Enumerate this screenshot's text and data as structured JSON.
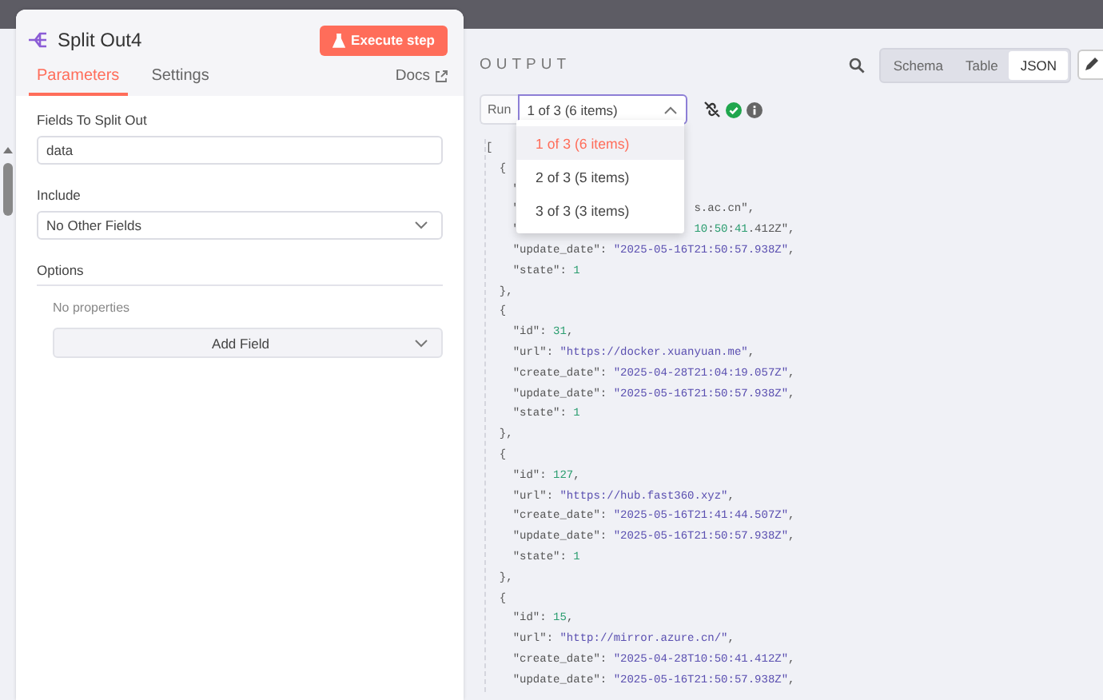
{
  "node": {
    "title": "Split Out4",
    "execute_button": "Execute step",
    "tabs": [
      {
        "label": "Parameters",
        "selected": true
      },
      {
        "label": "Settings",
        "selected": false
      }
    ],
    "docs_link": "Docs",
    "fields": [
      {
        "kind": "text",
        "label": "Fields To Split Out",
        "value": "data"
      },
      {
        "kind": "select",
        "label": "Include",
        "value": "No Other Fields"
      }
    ],
    "options": {
      "label": "Options",
      "empty_text": "No properties",
      "add_button": "Add Field"
    }
  },
  "output": {
    "title": "OUTPUT",
    "views": [
      {
        "label": "Schema",
        "selected": false
      },
      {
        "label": "Table",
        "selected": false
      },
      {
        "label": "JSON",
        "selected": true
      }
    ],
    "run": {
      "label": "Run",
      "value": "1 of 3 (6 items)",
      "expanded": true,
      "options": [
        {
          "label": "1 of 3 (6 items)",
          "selected": true
        },
        {
          "label": "2 of 3 (5 items)",
          "selected": false
        },
        {
          "label": "3 of 3 (3 items)",
          "selected": false
        }
      ]
    },
    "code_lines": [
      {
        "text": "["
      },
      {
        "text": "  {"
      },
      {
        "text": "    \""
      },
      {
        "text": "    \"",
        "tail": "s.ac.cn\","
      },
      {
        "text": "    \"",
        "tail": "10:50:41.412Z\","
      },
      {
        "text": "    \"update_date\": \"2025-05-16T21:50:57.938Z\","
      },
      {
        "text": "    \"state\": 1"
      },
      {
        "text": "  },"
      },
      {
        "text": "  {"
      },
      {
        "text": "    \"id\": 31,"
      },
      {
        "text": "    \"url\": \"https://docker.xuanyuan.me\","
      },
      {
        "text": "    \"create_date\": \"2025-04-28T21:04:19.057Z\","
      },
      {
        "text": "    \"update_date\": \"2025-05-16T21:50:57.938Z\","
      },
      {
        "text": "    \"state\": 1"
      },
      {
        "text": "  },"
      },
      {
        "text": "  {"
      },
      {
        "text": "    \"id\": 127,"
      },
      {
        "text": "    \"url\": \"https://hub.fast360.xyz\","
      },
      {
        "text": "    \"create_date\": \"2025-05-16T21:41:44.507Z\","
      },
      {
        "text": "    \"update_date\": \"2025-05-16T21:50:57.938Z\","
      },
      {
        "text": "    \"state\": 1"
      },
      {
        "text": "  },"
      },
      {
        "text": "  {"
      },
      {
        "text": "    \"id\": 15,"
      },
      {
        "text": "    \"url\": \"http://mirror.azure.cn/\","
      },
      {
        "text": "    \"create_date\": \"2025-04-28T10:50:41.412Z\","
      },
      {
        "text": "    \"update_date\": \"2025-05-16T21:50:57.938Z\","
      }
    ]
  }
}
